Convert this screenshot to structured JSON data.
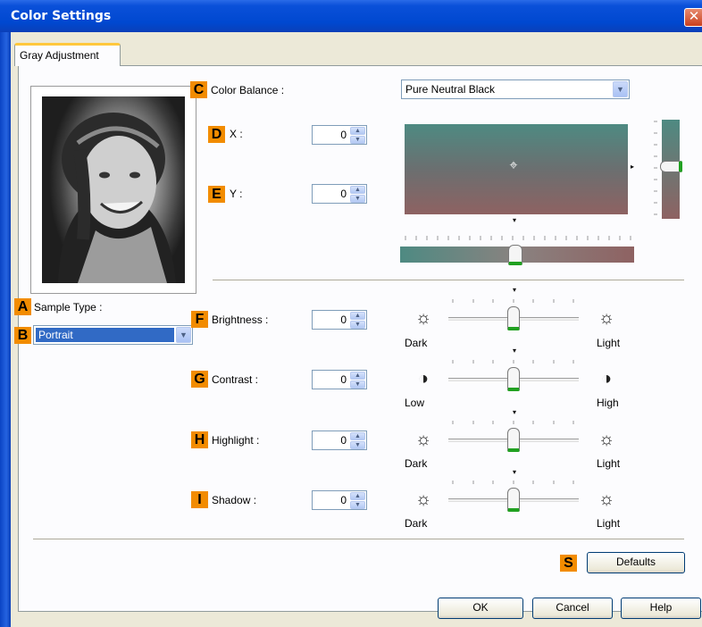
{
  "window": {
    "title": "Color Settings"
  },
  "tabs": [
    {
      "label": "Gray Adjustment"
    }
  ],
  "badges": {
    "a": "A",
    "b": "B",
    "c": "C",
    "d": "D",
    "e": "E",
    "f": "F",
    "g": "G",
    "h": "H",
    "i": "I",
    "s": "S"
  },
  "sample_type": {
    "label": "Sample Type :",
    "value": "Portrait"
  },
  "color_balance": {
    "label": "Color Balance :",
    "value": "Pure Neutral Black"
  },
  "x": {
    "label": "X :",
    "value": "0"
  },
  "y": {
    "label": "Y :",
    "value": "0"
  },
  "adjustments": [
    {
      "label": "Brightness :",
      "value": "0",
      "low": "Dark",
      "high": "Light",
      "low_icon": "sun-dim-icon",
      "high_icon": "sun-bright-icon"
    },
    {
      "label": "Contrast :",
      "value": "0",
      "low": "Low",
      "high": "High",
      "low_icon": "contrast-low-icon",
      "high_icon": "contrast-high-icon"
    },
    {
      "label": "Highlight :",
      "value": "0",
      "low": "Dark",
      "high": "Light",
      "low_icon": "sun-dim-icon",
      "high_icon": "sun-bright-icon"
    },
    {
      "label": "Shadow :",
      "value": "0",
      "low": "Dark",
      "high": "Light",
      "low_icon": "sun-dim-icon",
      "high_icon": "sun-bright-icon"
    }
  ],
  "buttons": {
    "defaults": "Defaults",
    "ok": "OK",
    "cancel": "Cancel",
    "help": "Help"
  },
  "colors": {
    "titlebar": "#0048d0",
    "badge": "#f28c00",
    "selection": "#316ac5",
    "thumb_accent": "#21a121"
  }
}
